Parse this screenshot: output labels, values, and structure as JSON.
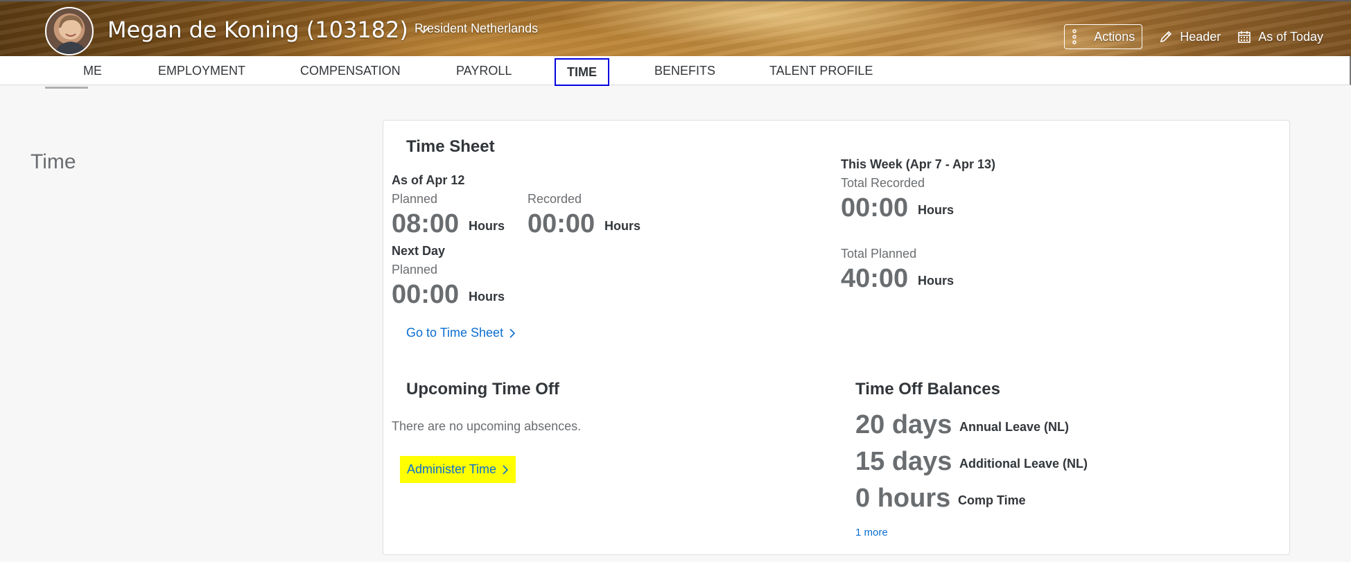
{
  "header": {
    "person_name": "Megan de Koning (103182)",
    "job_title": "President Netherlands",
    "actions_label": "Actions",
    "header_label": "Header",
    "as_of_label": "As of Today"
  },
  "nav": {
    "tabs": [
      {
        "label": "ME"
      },
      {
        "label": "EMPLOYMENT"
      },
      {
        "label": "COMPENSATION"
      },
      {
        "label": "PAYROLL"
      },
      {
        "label": "TIME"
      },
      {
        "label": "BENEFITS"
      },
      {
        "label": "TALENT PROFILE"
      }
    ],
    "active_tab": "TIME"
  },
  "page": {
    "section_title": "Time"
  },
  "time_sheet": {
    "title": "Time Sheet",
    "as_of": "As of Apr 12",
    "planned_label": "Planned",
    "planned_value": "08:00",
    "recorded_label": "Recorded",
    "recorded_value": "00:00",
    "hours_unit": "Hours",
    "next_day_label": "Next Day",
    "next_day_planned_label": "Planned",
    "next_day_planned_value": "00:00",
    "week_label": "This Week (Apr 7 - Apr 13)",
    "total_recorded_label": "Total Recorded",
    "total_recorded_value": "00:00",
    "total_planned_label": "Total Planned",
    "total_planned_value": "40:00",
    "go_link": "Go to Time Sheet"
  },
  "upcoming": {
    "title": "Upcoming Time Off",
    "empty_text": "There are no upcoming absences.",
    "administer_link": "Administer Time"
  },
  "balances": {
    "title": "Time Off Balances",
    "items": [
      {
        "amount": "20 days",
        "type": "Annual Leave (NL)"
      },
      {
        "amount": "15 days",
        "type": "Additional Leave (NL)"
      },
      {
        "amount": "0 hours",
        "type": "Comp Time"
      }
    ],
    "more_link": "1 more"
  },
  "colors": {
    "link": "#0a6ed1",
    "active_tab_border": "#0000e0",
    "highlight": "#ffff00"
  }
}
